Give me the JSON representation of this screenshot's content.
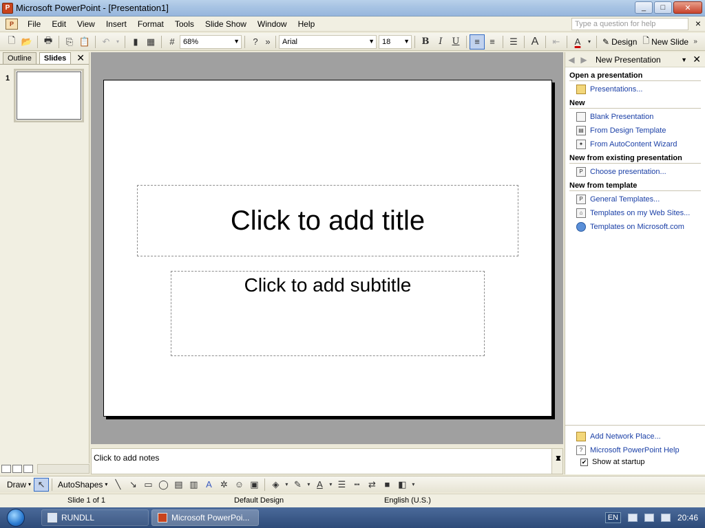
{
  "window": {
    "title": "Microsoft PowerPoint - [Presentation1]",
    "min": "_",
    "max": "□",
    "close": "✕"
  },
  "menu": {
    "items": [
      "File",
      "Edit",
      "View",
      "Insert",
      "Format",
      "Tools",
      "Slide Show",
      "Window",
      "Help"
    ],
    "ask_placeholder": "Type a question for help",
    "close": "×"
  },
  "toolbar": {
    "zoom": "68%",
    "font": "Arial",
    "font_size": "18",
    "bold": "B",
    "italic": "I",
    "underline": "U",
    "grow_font": "A",
    "font_color": "A",
    "design": "Design",
    "new_slide": "New Slide"
  },
  "left_pane": {
    "tabs": [
      "Outline",
      "Slides"
    ],
    "active_tab": "Slides",
    "slide_number": "1",
    "close": "✕"
  },
  "slide": {
    "title_placeholder": "Click to add title",
    "subtitle_placeholder": "Click to add subtitle"
  },
  "notes": {
    "placeholder": "Click to add notes"
  },
  "task_pane": {
    "title": "New Presentation",
    "sections": [
      {
        "heading": "Open a presentation",
        "links": [
          "Presentations..."
        ]
      },
      {
        "heading": "New",
        "links": [
          "Blank Presentation",
          "From Design Template",
          "From AutoContent Wizard"
        ]
      },
      {
        "heading": "New from existing presentation",
        "links": [
          "Choose presentation..."
        ]
      },
      {
        "heading": "New from template",
        "links": [
          "General Templates...",
          "Templates on my Web Sites...",
          "Templates on Microsoft.com"
        ]
      }
    ],
    "bottom_links": [
      "Add Network Place...",
      "Microsoft PowerPoint Help"
    ],
    "show_at_startup": "Show at startup",
    "show_at_startup_checked": true
  },
  "drawbar": {
    "draw": "Draw",
    "autoshapes": "AutoShapes"
  },
  "status": {
    "slide": "Slide 1 of 1",
    "design": "Default Design",
    "language": "English (U.S.)"
  },
  "taskbar": {
    "tasks": [
      "RUNDLL",
      "Microsoft PowerPoi..."
    ],
    "lang": "EN",
    "clock": "20:46"
  }
}
